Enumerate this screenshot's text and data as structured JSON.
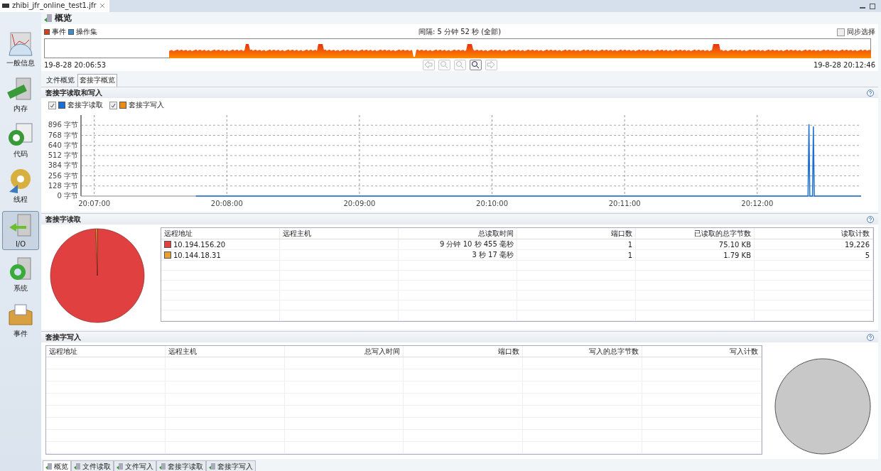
{
  "editor_tab": {
    "title": "zhibi_jfr_online_test1.jfr"
  },
  "sidebar": {
    "items": [
      {
        "label": "一般信息",
        "selected": false
      },
      {
        "label": "内存",
        "selected": false
      },
      {
        "label": "代码",
        "selected": false
      },
      {
        "label": "线程",
        "selected": false
      },
      {
        "label": "I/O",
        "selected": true
      },
      {
        "label": "系统",
        "selected": false
      },
      {
        "label": "事件",
        "selected": false
      }
    ]
  },
  "page_title": "概览",
  "timeline": {
    "legend": [
      {
        "label": "事件",
        "color": "#d8401c"
      },
      {
        "label": "操作集",
        "color": "#3a8fd0"
      }
    ],
    "interval": "间隔: 5 分钟 52 秒 (全部)",
    "sync_select": {
      "label": "同步选择",
      "checked": false
    },
    "start": "19-8-28 20:06:53",
    "end": "19-8-28 20:12:46",
    "nav_buttons": [
      {
        "disabled": true
      },
      {
        "disabled": true
      },
      {
        "disabled": true
      },
      {
        "disabled": false
      },
      {
        "disabled": true
      }
    ]
  },
  "sub_tabs": [
    {
      "label": "文件概览",
      "selected": false
    },
    {
      "label": "套接字概览",
      "selected": true
    }
  ],
  "io_chart": {
    "title": "套接字读取和写入",
    "legend": [
      {
        "checked": true
      },
      {
        "checked": true
      }
    ],
    "chart_data": {
      "type": "line",
      "grid": true,
      "x": [
        72466,
        72743,
        72743.4,
        72743.8,
        72745,
        72745.4,
        72745.8,
        72767
      ],
      "series": [
        {
          "name": "套接字读取",
          "color": "#1a6fd4",
          "values": [
            0,
            0,
            910,
            0,
            0,
            880,
            0,
            0
          ]
        },
        {
          "name": "套接字写入",
          "color": "#f08a10",
          "values": [
            null,
            null,
            null,
            null,
            null,
            null,
            null,
            null
          ]
        }
      ],
      "xlim": [
        72414,
        72767
      ],
      "ylim": [
        0,
        1024
      ],
      "xticks": [
        {
          "value": 72420,
          "label": "20:07:00"
        },
        {
          "value": 72480,
          "label": "20:08:00"
        },
        {
          "value": 72540,
          "label": "20:09:00"
        },
        {
          "value": 72600,
          "label": "20:10:00"
        },
        {
          "value": 72660,
          "label": "20:11:00"
        },
        {
          "value": 72720,
          "label": "20:12:00"
        }
      ],
      "yticks": [
        {
          "value": 0,
          "label": "0 字节"
        },
        {
          "value": 128,
          "label": "128 字节"
        },
        {
          "value": 256,
          "label": "256 字节"
        },
        {
          "value": 384,
          "label": "384 字节"
        },
        {
          "value": 512,
          "label": "512 字节"
        },
        {
          "value": 640,
          "label": "640 字节"
        },
        {
          "value": 768,
          "label": "768 字节"
        },
        {
          "value": 896,
          "label": "896 字节"
        }
      ]
    }
  },
  "socket_read": {
    "title": "套接字读取",
    "chart_data": {
      "type": "pie",
      "values": [
        99.45,
        0.55
      ]
    },
    "columns": [
      "远程地址",
      "远程主机",
      "总读取时间",
      "端口数",
      "已读取的总字节数",
      "读取计数"
    ],
    "rows": [
      {
        "color": "#e04040",
        "cells": [
          "10.194.156.20",
          "",
          "9 分钟 10 秒 455 毫秒",
          "1",
          "75.10 KB",
          "19,226"
        ]
      },
      {
        "color": "#e8a030",
        "cells": [
          "10.144.18.31",
          "",
          "3 秒 17 毫秒",
          "1",
          "1.79 KB",
          "5"
        ]
      }
    ]
  },
  "socket_write": {
    "title": "套接字写入",
    "columns": [
      "远程地址",
      "远程主机",
      "总写入时间",
      "端口数",
      "写入的总字节数",
      "写入计数"
    ]
  },
  "bottom_tabs": [
    {
      "label": "概览",
      "selected": true
    },
    {
      "label": "文件读取",
      "selected": false
    },
    {
      "label": "文件写入",
      "selected": false
    },
    {
      "label": "套接字读取",
      "selected": false
    },
    {
      "label": "套接字写入",
      "selected": false
    }
  ]
}
